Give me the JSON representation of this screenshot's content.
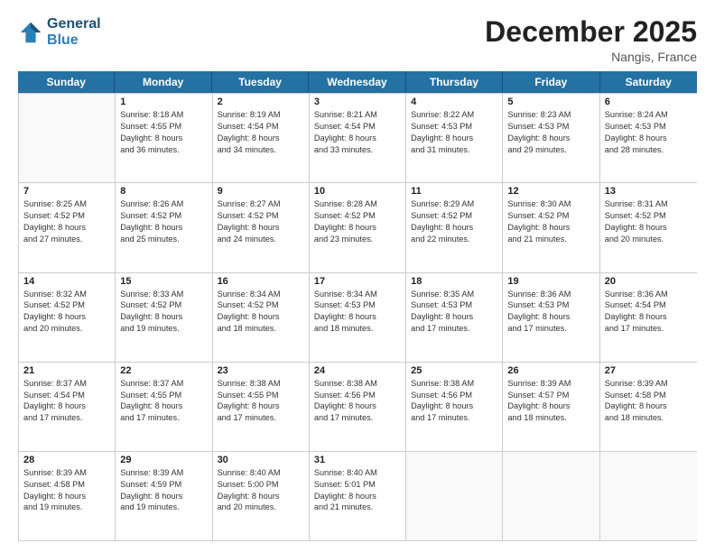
{
  "logo": {
    "line1": "General",
    "line2": "Blue"
  },
  "title": "December 2025",
  "location": "Nangis, France",
  "header_days": [
    "Sunday",
    "Monday",
    "Tuesday",
    "Wednesday",
    "Thursday",
    "Friday",
    "Saturday"
  ],
  "weeks": [
    [
      {
        "day": "",
        "sunrise": "",
        "sunset": "",
        "daylight": ""
      },
      {
        "day": "1",
        "sunrise": "Sunrise: 8:18 AM",
        "sunset": "Sunset: 4:55 PM",
        "daylight": "Daylight: 8 hours and 36 minutes."
      },
      {
        "day": "2",
        "sunrise": "Sunrise: 8:19 AM",
        "sunset": "Sunset: 4:54 PM",
        "daylight": "Daylight: 8 hours and 34 minutes."
      },
      {
        "day": "3",
        "sunrise": "Sunrise: 8:21 AM",
        "sunset": "Sunset: 4:54 PM",
        "daylight": "Daylight: 8 hours and 33 minutes."
      },
      {
        "day": "4",
        "sunrise": "Sunrise: 8:22 AM",
        "sunset": "Sunset: 4:53 PM",
        "daylight": "Daylight: 8 hours and 31 minutes."
      },
      {
        "day": "5",
        "sunrise": "Sunrise: 8:23 AM",
        "sunset": "Sunset: 4:53 PM",
        "daylight": "Daylight: 8 hours and 29 minutes."
      },
      {
        "day": "6",
        "sunrise": "Sunrise: 8:24 AM",
        "sunset": "Sunset: 4:53 PM",
        "daylight": "Daylight: 8 hours and 28 minutes."
      }
    ],
    [
      {
        "day": "7",
        "sunrise": "Sunrise: 8:25 AM",
        "sunset": "Sunset: 4:52 PM",
        "daylight": "Daylight: 8 hours and 27 minutes."
      },
      {
        "day": "8",
        "sunrise": "Sunrise: 8:26 AM",
        "sunset": "Sunset: 4:52 PM",
        "daylight": "Daylight: 8 hours and 25 minutes."
      },
      {
        "day": "9",
        "sunrise": "Sunrise: 8:27 AM",
        "sunset": "Sunset: 4:52 PM",
        "daylight": "Daylight: 8 hours and 24 minutes."
      },
      {
        "day": "10",
        "sunrise": "Sunrise: 8:28 AM",
        "sunset": "Sunset: 4:52 PM",
        "daylight": "Daylight: 8 hours and 23 minutes."
      },
      {
        "day": "11",
        "sunrise": "Sunrise: 8:29 AM",
        "sunset": "Sunset: 4:52 PM",
        "daylight": "Daylight: 8 hours and 22 minutes."
      },
      {
        "day": "12",
        "sunrise": "Sunrise: 8:30 AM",
        "sunset": "Sunset: 4:52 PM",
        "daylight": "Daylight: 8 hours and 21 minutes."
      },
      {
        "day": "13",
        "sunrise": "Sunrise: 8:31 AM",
        "sunset": "Sunset: 4:52 PM",
        "daylight": "Daylight: 8 hours and 20 minutes."
      }
    ],
    [
      {
        "day": "14",
        "sunrise": "Sunrise: 8:32 AM",
        "sunset": "Sunset: 4:52 PM",
        "daylight": "Daylight: 8 hours and 20 minutes."
      },
      {
        "day": "15",
        "sunrise": "Sunrise: 8:33 AM",
        "sunset": "Sunset: 4:52 PM",
        "daylight": "Daylight: 8 hours and 19 minutes."
      },
      {
        "day": "16",
        "sunrise": "Sunrise: 8:34 AM",
        "sunset": "Sunset: 4:52 PM",
        "daylight": "Daylight: 8 hours and 18 minutes."
      },
      {
        "day": "17",
        "sunrise": "Sunrise: 8:34 AM",
        "sunset": "Sunset: 4:53 PM",
        "daylight": "Daylight: 8 hours and 18 minutes."
      },
      {
        "day": "18",
        "sunrise": "Sunrise: 8:35 AM",
        "sunset": "Sunset: 4:53 PM",
        "daylight": "Daylight: 8 hours and 17 minutes."
      },
      {
        "day": "19",
        "sunrise": "Sunrise: 8:36 AM",
        "sunset": "Sunset: 4:53 PM",
        "daylight": "Daylight: 8 hours and 17 minutes."
      },
      {
        "day": "20",
        "sunrise": "Sunrise: 8:36 AM",
        "sunset": "Sunset: 4:54 PM",
        "daylight": "Daylight: 8 hours and 17 minutes."
      }
    ],
    [
      {
        "day": "21",
        "sunrise": "Sunrise: 8:37 AM",
        "sunset": "Sunset: 4:54 PM",
        "daylight": "Daylight: 8 hours and 17 minutes."
      },
      {
        "day": "22",
        "sunrise": "Sunrise: 8:37 AM",
        "sunset": "Sunset: 4:55 PM",
        "daylight": "Daylight: 8 hours and 17 minutes."
      },
      {
        "day": "23",
        "sunrise": "Sunrise: 8:38 AM",
        "sunset": "Sunset: 4:55 PM",
        "daylight": "Daylight: 8 hours and 17 minutes."
      },
      {
        "day": "24",
        "sunrise": "Sunrise: 8:38 AM",
        "sunset": "Sunset: 4:56 PM",
        "daylight": "Daylight: 8 hours and 17 minutes."
      },
      {
        "day": "25",
        "sunrise": "Sunrise: 8:38 AM",
        "sunset": "Sunset: 4:56 PM",
        "daylight": "Daylight: 8 hours and 17 minutes."
      },
      {
        "day": "26",
        "sunrise": "Sunrise: 8:39 AM",
        "sunset": "Sunset: 4:57 PM",
        "daylight": "Daylight: 8 hours and 18 minutes."
      },
      {
        "day": "27",
        "sunrise": "Sunrise: 8:39 AM",
        "sunset": "Sunset: 4:58 PM",
        "daylight": "Daylight: 8 hours and 18 minutes."
      }
    ],
    [
      {
        "day": "28",
        "sunrise": "Sunrise: 8:39 AM",
        "sunset": "Sunset: 4:58 PM",
        "daylight": "Daylight: 8 hours and 19 minutes."
      },
      {
        "day": "29",
        "sunrise": "Sunrise: 8:39 AM",
        "sunset": "Sunset: 4:59 PM",
        "daylight": "Daylight: 8 hours and 19 minutes."
      },
      {
        "day": "30",
        "sunrise": "Sunrise: 8:40 AM",
        "sunset": "Sunset: 5:00 PM",
        "daylight": "Daylight: 8 hours and 20 minutes."
      },
      {
        "day": "31",
        "sunrise": "Sunrise: 8:40 AM",
        "sunset": "Sunset: 5:01 PM",
        "daylight": "Daylight: 8 hours and 21 minutes."
      },
      {
        "day": "",
        "sunrise": "",
        "sunset": "",
        "daylight": ""
      },
      {
        "day": "",
        "sunrise": "",
        "sunset": "",
        "daylight": ""
      },
      {
        "day": "",
        "sunrise": "",
        "sunset": "",
        "daylight": ""
      }
    ]
  ]
}
